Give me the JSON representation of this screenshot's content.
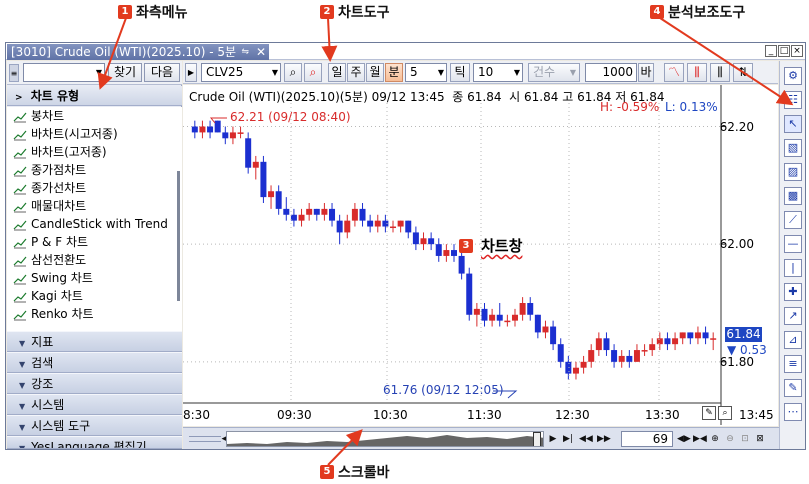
{
  "callouts": {
    "left_menu": {
      "num": "1",
      "label": "좌측메뉴"
    },
    "chart_tools": {
      "num": "2",
      "label": "차트도구"
    },
    "analysis_tools": {
      "num": "4",
      "label": "분석보조도구"
    },
    "chart_window": {
      "num": "3",
      "label": "차트창"
    },
    "scrollbar": {
      "num": "5",
      "label": "스크롤바"
    }
  },
  "window": {
    "tab_title": "[3010] Crude Oil (WTI)(2025.10) - 5분",
    "sync_icon": "sync-icon",
    "buttons": [
      "_",
      "□",
      "×"
    ]
  },
  "left_panel": {
    "search_value": "",
    "find_label": "찾기",
    "next_label": "다음",
    "chart_type_header": "차트 유형",
    "chart_types": [
      "봉차트",
      "바차트(시고저종)",
      "바차트(고저종)",
      "종가점차트",
      "종가선차트",
      "매물대차트",
      "CandleStick with Trend",
      "P & F 차트",
      "삼선전환도",
      "Swing 차트",
      "Kagi 차트",
      "Renko 차트"
    ],
    "sections": [
      "지표",
      "검색",
      "강조",
      "시스템",
      "시스템 도구",
      "YesLanguage 편집기"
    ]
  },
  "toolbar": {
    "symbol": "CLV25",
    "period_buttons": [
      "일",
      "주",
      "월",
      "분"
    ],
    "active_period": "분",
    "interval_value": "5",
    "tick_label": "틱",
    "tick_value": "10",
    "count_label": "건수",
    "count_value": "1000",
    "bar_label": "바"
  },
  "chart": {
    "header": {
      "name": "Crude Oil (WTI)(2025.10)(5분)",
      "datetime": "09/12 13:45",
      "close_label": "종",
      "close": "61.84",
      "open_label": "시",
      "open": "61.84",
      "high_label": "고",
      "high": "61.84",
      "low_label": "저",
      "low": "61.84"
    },
    "high_pct": "H: -0.59%",
    "low_pct": "L: 0.13%",
    "last_price": "61.84",
    "change": "▼ 0.53",
    "annotation_high": "62.21 (09/12 08:40)",
    "annotation_low": "61.76 (09/12 12:05)",
    "up_color": "#d82b2b",
    "down_color": "#1b2fd0"
  },
  "chart_data": {
    "type": "candlestick",
    "title": "Crude Oil (WTI)(2025.10)(5분)",
    "x_ticks": [
      "8:30",
      "09:30",
      "10:30",
      "11:30",
      "12:30",
      "13:30",
      "13:45"
    ],
    "y_ticks": [
      "62.20",
      "62.00",
      "61.80"
    ],
    "ylim": [
      61.73,
      62.24
    ],
    "grid": true,
    "series": [
      {
        "o": 62.2,
        "h": 62.21,
        "l": 62.18,
        "c": 62.19
      },
      {
        "o": 62.19,
        "h": 62.21,
        "l": 62.18,
        "c": 62.2
      },
      {
        "o": 62.2,
        "h": 62.21,
        "l": 62.18,
        "c": 62.19
      },
      {
        "o": 62.21,
        "h": 62.21,
        "l": 62.19,
        "c": 62.19
      },
      {
        "o": 62.19,
        "h": 62.2,
        "l": 62.17,
        "c": 62.18
      },
      {
        "o": 62.18,
        "h": 62.2,
        "l": 62.17,
        "c": 62.19
      },
      {
        "o": 62.19,
        "h": 62.2,
        "l": 62.18,
        "c": 62.19
      },
      {
        "o": 62.18,
        "h": 62.19,
        "l": 62.12,
        "c": 62.13
      },
      {
        "o": 62.13,
        "h": 62.15,
        "l": 62.11,
        "c": 62.14
      },
      {
        "o": 62.14,
        "h": 62.15,
        "l": 62.07,
        "c": 62.08
      },
      {
        "o": 62.08,
        "h": 62.1,
        "l": 62.06,
        "c": 62.09
      },
      {
        "o": 62.09,
        "h": 62.1,
        "l": 62.05,
        "c": 62.06
      },
      {
        "o": 62.06,
        "h": 62.08,
        "l": 62.04,
        "c": 62.05
      },
      {
        "o": 62.05,
        "h": 62.06,
        "l": 62.03,
        "c": 62.04
      },
      {
        "o": 62.04,
        "h": 62.06,
        "l": 62.03,
        "c": 62.05
      },
      {
        "o": 62.05,
        "h": 62.07,
        "l": 62.04,
        "c": 62.06
      },
      {
        "o": 62.06,
        "h": 62.06,
        "l": 62.04,
        "c": 62.05
      },
      {
        "o": 62.05,
        "h": 62.07,
        "l": 62.04,
        "c": 62.06
      },
      {
        "o": 62.06,
        "h": 62.07,
        "l": 62.03,
        "c": 62.04
      },
      {
        "o": 62.04,
        "h": 62.05,
        "l": 62.0,
        "c": 62.02
      },
      {
        "o": 62.02,
        "h": 62.05,
        "l": 62.01,
        "c": 62.04
      },
      {
        "o": 62.04,
        "h": 62.07,
        "l": 62.03,
        "c": 62.06
      },
      {
        "o": 62.06,
        "h": 62.07,
        "l": 62.03,
        "c": 62.04
      },
      {
        "o": 62.04,
        "h": 62.05,
        "l": 62.02,
        "c": 62.03
      },
      {
        "o": 62.03,
        "h": 62.05,
        "l": 62.02,
        "c": 62.04
      },
      {
        "o": 62.04,
        "h": 62.05,
        "l": 62.02,
        "c": 62.03
      },
      {
        "o": 62.03,
        "h": 62.04,
        "l": 62.02,
        "c": 62.03
      },
      {
        "o": 62.03,
        "h": 62.04,
        "l": 62.02,
        "c": 62.04
      },
      {
        "o": 62.04,
        "h": 62.04,
        "l": 62.01,
        "c": 62.02
      },
      {
        "o": 62.02,
        "h": 62.03,
        "l": 61.99,
        "c": 62.0
      },
      {
        "o": 62.0,
        "h": 62.02,
        "l": 61.99,
        "c": 62.01
      },
      {
        "o": 62.01,
        "h": 62.02,
        "l": 61.99,
        "c": 62.0
      },
      {
        "o": 62.0,
        "h": 62.01,
        "l": 61.97,
        "c": 61.98
      },
      {
        "o": 61.98,
        "h": 62.0,
        "l": 61.97,
        "c": 61.99
      },
      {
        "o": 61.99,
        "h": 62.0,
        "l": 61.97,
        "c": 61.98
      },
      {
        "o": 61.98,
        "h": 61.99,
        "l": 61.94,
        "c": 61.95
      },
      {
        "o": 61.95,
        "h": 61.96,
        "l": 61.87,
        "c": 61.88
      },
      {
        "o": 61.88,
        "h": 61.9,
        "l": 61.86,
        "c": 61.89
      },
      {
        "o": 61.89,
        "h": 61.9,
        "l": 61.86,
        "c": 61.87
      },
      {
        "o": 61.87,
        "h": 61.89,
        "l": 61.86,
        "c": 61.88
      },
      {
        "o": 61.88,
        "h": 61.9,
        "l": 61.86,
        "c": 61.87
      },
      {
        "o": 61.87,
        "h": 61.88,
        "l": 61.86,
        "c": 61.87
      },
      {
        "o": 61.87,
        "h": 61.89,
        "l": 61.86,
        "c": 61.88
      },
      {
        "o": 61.88,
        "h": 61.91,
        "l": 61.87,
        "c": 61.9
      },
      {
        "o": 61.9,
        "h": 61.91,
        "l": 61.87,
        "c": 61.88
      },
      {
        "o": 61.88,
        "h": 61.88,
        "l": 61.84,
        "c": 61.85
      },
      {
        "o": 61.85,
        "h": 61.87,
        "l": 61.84,
        "c": 61.86
      },
      {
        "o": 61.86,
        "h": 61.87,
        "l": 61.82,
        "c": 61.83
      },
      {
        "o": 61.83,
        "h": 61.84,
        "l": 61.79,
        "c": 61.8
      },
      {
        "o": 61.8,
        "h": 61.81,
        "l": 61.77,
        "c": 61.78
      },
      {
        "o": 61.78,
        "h": 61.8,
        "l": 61.77,
        "c": 61.79
      },
      {
        "o": 61.79,
        "h": 61.81,
        "l": 61.78,
        "c": 61.8
      },
      {
        "o": 61.8,
        "h": 61.83,
        "l": 61.79,
        "c": 61.82
      },
      {
        "o": 61.82,
        "h": 61.85,
        "l": 61.81,
        "c": 61.84
      },
      {
        "o": 61.84,
        "h": 61.85,
        "l": 61.81,
        "c": 61.82
      },
      {
        "o": 61.82,
        "h": 61.83,
        "l": 61.79,
        "c": 61.8
      },
      {
        "o": 61.8,
        "h": 61.82,
        "l": 61.79,
        "c": 61.81
      },
      {
        "o": 61.81,
        "h": 61.82,
        "l": 61.79,
        "c": 61.8
      },
      {
        "o": 61.8,
        "h": 61.83,
        "l": 61.8,
        "c": 61.82
      },
      {
        "o": 61.82,
        "h": 61.83,
        "l": 61.81,
        "c": 61.82
      },
      {
        "o": 61.82,
        "h": 61.84,
        "l": 61.81,
        "c": 61.83
      },
      {
        "o": 61.83,
        "h": 61.85,
        "l": 61.82,
        "c": 61.84
      },
      {
        "o": 61.84,
        "h": 61.85,
        "l": 61.82,
        "c": 61.83
      },
      {
        "o": 61.83,
        "h": 61.85,
        "l": 61.82,
        "c": 61.84
      },
      {
        "o": 61.84,
        "h": 61.85,
        "l": 61.83,
        "c": 61.85
      },
      {
        "o": 61.85,
        "h": 61.85,
        "l": 61.83,
        "c": 61.84
      },
      {
        "o": 61.84,
        "h": 61.86,
        "l": 61.83,
        "c": 61.85
      },
      {
        "o": 61.85,
        "h": 61.86,
        "l": 61.83,
        "c": 61.84
      },
      {
        "o": 61.84,
        "h": 61.85,
        "l": 61.82,
        "c": 61.84
      }
    ]
  },
  "scrollbar": {
    "value": "69"
  },
  "right_tools": [
    "settings-icon",
    "compare-icon",
    "cursor-icon",
    "pattern-icon",
    "data-icon",
    "channel-icon",
    "trendline-icon",
    "hline-icon",
    "vline-icon",
    "cross-icon",
    "ray-icon",
    "fib-icon",
    "text-icon",
    "draw-icon",
    "more-icon"
  ]
}
